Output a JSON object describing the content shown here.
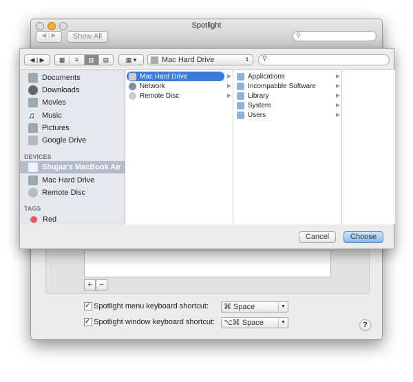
{
  "window": {
    "title": "Spotlight",
    "show_all": "Show All"
  },
  "sheet": {
    "location": "Mac Hard Drive",
    "sidebar": {
      "favorites": [
        "Documents",
        "Downloads",
        "Movies",
        "Music",
        "Pictures",
        "Google Drive"
      ],
      "devices_header": "DEVICES",
      "devices": [
        "Shujaa's MacBook Air",
        "Mac Hard Drive",
        "Remote Disc"
      ],
      "tags_header": "TAGS",
      "tags": [
        "Red"
      ]
    },
    "column1": [
      "Mac Hard Drive",
      "Network",
      "Remote Disc"
    ],
    "column2": [
      "Applications",
      "Incompatible Software",
      "Library",
      "System",
      "Users"
    ],
    "cancel": "Cancel",
    "choose": "Choose"
  },
  "prefs": {
    "menu_shortcut_label": "Spotlight menu keyboard shortcut:",
    "menu_shortcut_value": "⌘ Space",
    "window_shortcut_label": "Spotlight window keyboard shortcut:",
    "window_shortcut_value": "⌥⌘ Space",
    "add": "+",
    "remove": "−",
    "help": "?"
  },
  "colors": {
    "accent": "#3b7bdc",
    "red_tag": "#e85a5a"
  }
}
